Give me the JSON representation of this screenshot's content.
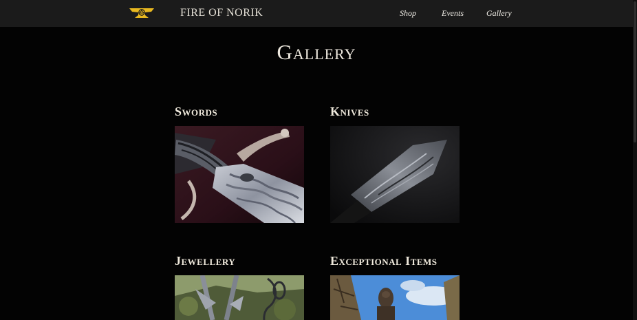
{
  "nav": {
    "brand": "FIRE OF NORIK",
    "logo_icon": "anvil-logo-icon",
    "links": [
      "Shop",
      "Events",
      "Gallery"
    ]
  },
  "page": {
    "title": "Gallery"
  },
  "categories": [
    {
      "title": "Swords",
      "image": "sword-damascus-photo"
    },
    {
      "title": "Knives",
      "image": "knife-damascus-photo"
    },
    {
      "title": "Jewellery",
      "image": "forged-jewellery-photo"
    },
    {
      "title": "Exceptional Items",
      "image": "wooden-sculpture-photo"
    }
  ],
  "colors": {
    "background": "#030303",
    "nav_background": "#1b1b1b",
    "logo_gold": "#e8b820",
    "text": "#efe9dc"
  }
}
